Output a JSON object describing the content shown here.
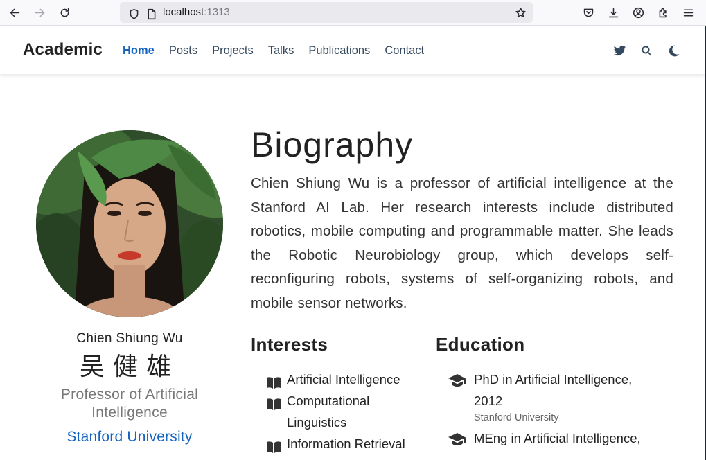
{
  "browser": {
    "url_host": "localhost",
    "url_port": ":1313"
  },
  "nav": {
    "brand": "Academic",
    "links": [
      {
        "label": "Home",
        "active": true
      },
      {
        "label": "Posts"
      },
      {
        "label": "Projects"
      },
      {
        "label": "Talks"
      },
      {
        "label": "Publications"
      },
      {
        "label": "Contact"
      }
    ],
    "icons": [
      "twitter-icon",
      "search-icon",
      "moon-icon"
    ]
  },
  "profile": {
    "name": "Chien Shiung Wu",
    "name_cjk": "吴健雄",
    "role": "Professor of Artificial Intelligence",
    "organization": "Stanford University"
  },
  "bio": {
    "title": "Biography",
    "text": "Chien Shiung Wu is a professor of artificial intelligence at the Stanford AI Lab. Her research interests include distributed robotics, mobile computing and programmable matter. She leads the Robotic Neurobiology group, which develops self-reconfiguring robots, systems of self-organizing robots, and mobile sensor networks."
  },
  "interests": {
    "title": "Interests",
    "items": [
      "Artificial Intelligence",
      "Computational Linguistics",
      "Information Retrieval"
    ]
  },
  "education": {
    "title": "Education",
    "items": [
      {
        "degree": "PhD in Artificial Intelligence, 2012",
        "school": "Stanford University"
      },
      {
        "degree": "MEng in Artificial Intelligence,",
        "school": ""
      }
    ]
  },
  "colors": {
    "accent": "#1565c0",
    "nav_text": "#34495e"
  }
}
